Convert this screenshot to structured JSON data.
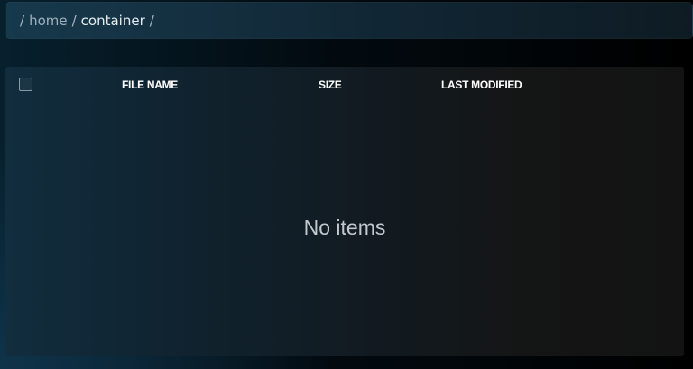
{
  "breadcrumb": {
    "separator": "/",
    "items": [
      {
        "label": "home"
      },
      {
        "label": "container"
      }
    ]
  },
  "table": {
    "columns": [
      {
        "label": "FILE NAME"
      },
      {
        "label": "SIZE"
      },
      {
        "label": "LAST MODIFIED"
      }
    ],
    "select_all_checked": false,
    "rows": [],
    "empty_text": "No items"
  }
}
